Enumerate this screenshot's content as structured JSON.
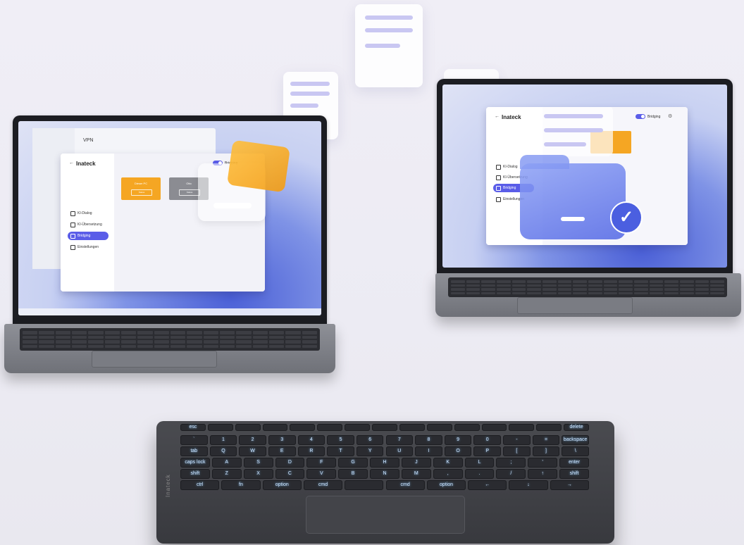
{
  "left_laptop": {
    "app": {
      "brand": "Inateck",
      "toggle_label": "Bridging",
      "menu": [
        "KI-Dialog",
        "KI-Übersetzung",
        "Bridging",
        "Einstellungen"
      ],
      "active_index": 2,
      "tiles": [
        {
          "label": "Dieser PC",
          "button": "Status",
          "color": "#f5a623"
        },
        {
          "label": "Otto",
          "button": "Status",
          "color": "#8b8c92"
        }
      ]
    },
    "background_window": {
      "title": "VPN"
    }
  },
  "right_laptop": {
    "app": {
      "brand": "Inateck",
      "toggle_label": "Bridging",
      "menu": [
        "KI-Dialog",
        "KI-Übersetzung",
        "Bridging",
        "Einstellungen"
      ],
      "active_index": 2
    }
  },
  "colors": {
    "accent": "#5a5de8",
    "tile_orange": "#f5a623",
    "folder_blue": "#6f86f0",
    "check_blue": "#4b5fe0"
  },
  "icons": [
    "folder-icon",
    "check-icon",
    "document-icon",
    "back-arrow-icon",
    "settings-icon"
  ],
  "keyboard": {
    "row1": [
      "esc",
      "",
      "",
      "",
      "",
      "",
      "",
      "",
      "",
      "",
      "",
      "",
      "",
      "",
      "delete"
    ],
    "row2": [
      "`",
      "1",
      "2",
      "3",
      "4",
      "5",
      "6",
      "7",
      "8",
      "9",
      "0",
      "-",
      "=",
      "backspace"
    ],
    "row3": [
      "tab",
      "Q",
      "W",
      "E",
      "R",
      "T",
      "Y",
      "U",
      "I",
      "O",
      "P",
      "[",
      "]",
      "\\"
    ],
    "row4": [
      "caps lock",
      "A",
      "S",
      "D",
      "F",
      "G",
      "H",
      "J",
      "K",
      "L",
      ";",
      "'",
      "enter"
    ],
    "row5": [
      "shift",
      "Z",
      "X",
      "C",
      "V",
      "B",
      "N",
      "M",
      ",",
      ".",
      "/",
      "↑",
      "shift"
    ],
    "row6": [
      "ctrl",
      "fn",
      "option",
      "cmd",
      "",
      "cmd",
      "option",
      "←",
      "↓",
      "→"
    ],
    "brand_vertical": "Inateck"
  }
}
